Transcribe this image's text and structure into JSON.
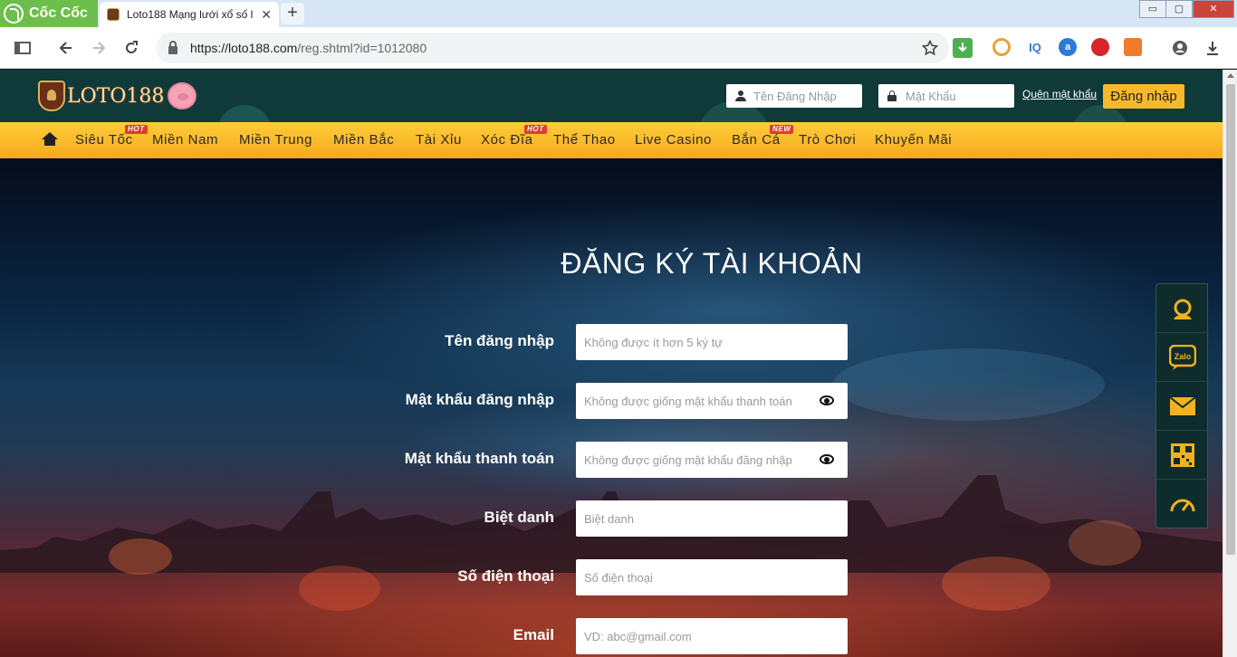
{
  "browser": {
    "brand": "Cốc Cốc",
    "tab_title": "Loto188 Mạng lưới xổ số l",
    "tab_close": "✕",
    "new_tab": "+",
    "window_controls": [
      "▭",
      "▢",
      "✕"
    ],
    "url_host": "https://loto188.com",
    "url_path": "/reg.shtml?id=1012080",
    "extensions": [
      "IQ",
      "a"
    ]
  },
  "header": {
    "logo_text": "LOTO188",
    "username_placeholder": "Tên Đăng Nhập",
    "password_placeholder": "Mật Khẩu",
    "forgot_link": "Quên mật khẩu",
    "login_button": "Đăng nhập"
  },
  "nav": {
    "items": [
      {
        "label": "Siêu Tốc",
        "badge": "HOT"
      },
      {
        "label": "Miền Nam",
        "badge": ""
      },
      {
        "label": "Miền Trung",
        "badge": ""
      },
      {
        "label": "Miền Bắc",
        "badge": ""
      },
      {
        "label": "Tài Xỉu",
        "badge": ""
      },
      {
        "label": "Xóc Đĩa",
        "badge": "HOT"
      },
      {
        "label": "Thể Thao",
        "badge": ""
      },
      {
        "label": "Live Casino",
        "badge": ""
      },
      {
        "label": "Bắn Cá",
        "badge": "NEW"
      },
      {
        "label": "Trò Chơi",
        "badge": ""
      },
      {
        "label": "Khuyến Mãi",
        "badge": ""
      }
    ]
  },
  "form": {
    "title": "ĐĂNG KÝ TÀI KHOẢN",
    "fields": [
      {
        "label": "Tên đăng nhập",
        "placeholder": "Không được ít hơn 5 ký tự",
        "eye": false
      },
      {
        "label": "Mật khẩu đăng nhập",
        "placeholder": "Không được giống mật khẩu thanh toán",
        "eye": true
      },
      {
        "label": "Mật khẩu thanh toán",
        "placeholder": "Không được giống mật khẩu đăng nhập",
        "eye": true
      },
      {
        "label": "Biệt danh",
        "placeholder": "Biệt danh",
        "eye": false
      },
      {
        "label": "Số điện thoại",
        "placeholder": "Số điện thoại",
        "eye": false
      },
      {
        "label": "Email",
        "placeholder": "VD: abc@gmail.com",
        "eye": false
      }
    ]
  },
  "side_widget": {
    "items": [
      "support-icon",
      "zalo-icon",
      "mail-icon",
      "qr-code-icon",
      "speedometer-icon"
    ],
    "zalo_text": "Zalo"
  },
  "colors": {
    "accent": "#f7b92b",
    "header_bg": "#0f3a39",
    "widget_icon": "#f2b11e"
  }
}
